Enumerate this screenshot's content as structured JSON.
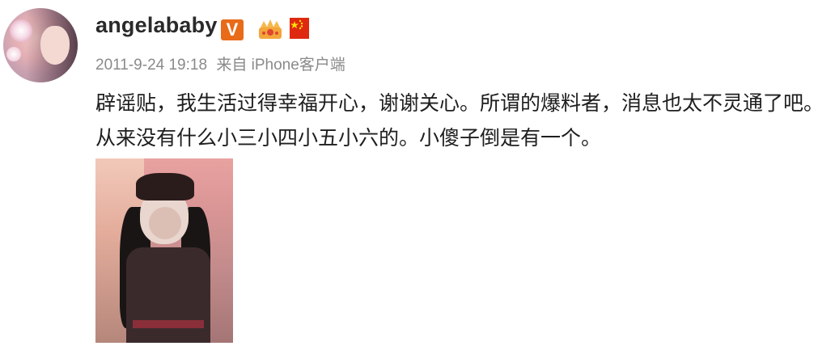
{
  "post": {
    "username": "angelababy",
    "verified_badge": "V",
    "timestamp": "2011-9-24 19:18",
    "source": "来自 iPhone客户端",
    "text": "辟谣贴，我生活过得幸福开心，谢谢关心。所谓的爆料者，消息也太不灵通了吧。从来没有什么小三小四小五小六的。小傻子倒是有一个。",
    "icons": [
      "crown-icon",
      "china-flag-icon"
    ]
  },
  "colors": {
    "verified": "#e86b1a",
    "meta_text": "#8a8a8a",
    "username": "#2a2a2a"
  }
}
